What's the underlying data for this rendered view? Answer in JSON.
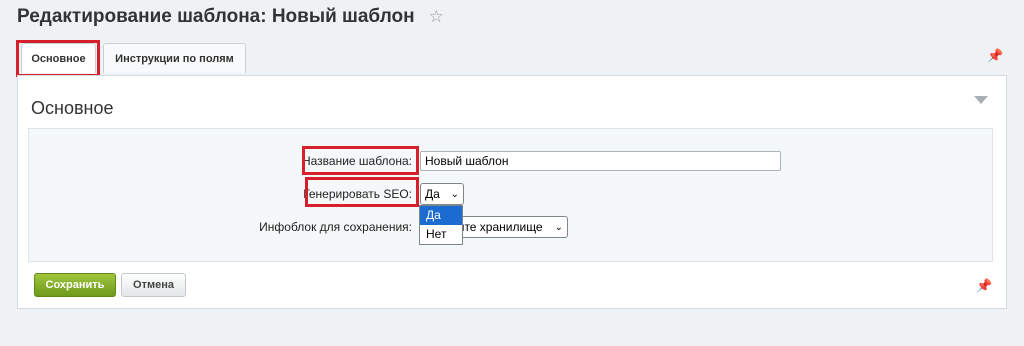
{
  "header": {
    "title": "Редактирование шаблона: Новый шаблон"
  },
  "tabs": [
    {
      "label": "Основное"
    },
    {
      "label": "Инструкции по полям"
    }
  ],
  "section": {
    "title": "Основное"
  },
  "form": {
    "name_label": "Название шаблона:",
    "name_value": "Новый шаблон",
    "seo_label": "Генерировать SEO:",
    "seo_selected": "Да",
    "seo_options": [
      "Да",
      "Нет"
    ],
    "iblock_label": "Инфоблок для сохранения:",
    "iblock_visible_text": "ите хранилище"
  },
  "buttons": {
    "save": "Сохранить",
    "cancel": "Отмена"
  },
  "colors": {
    "highlight": "#d6202b",
    "save_button": "#7fae25",
    "dropdown_selected": "#1b6bd1"
  }
}
